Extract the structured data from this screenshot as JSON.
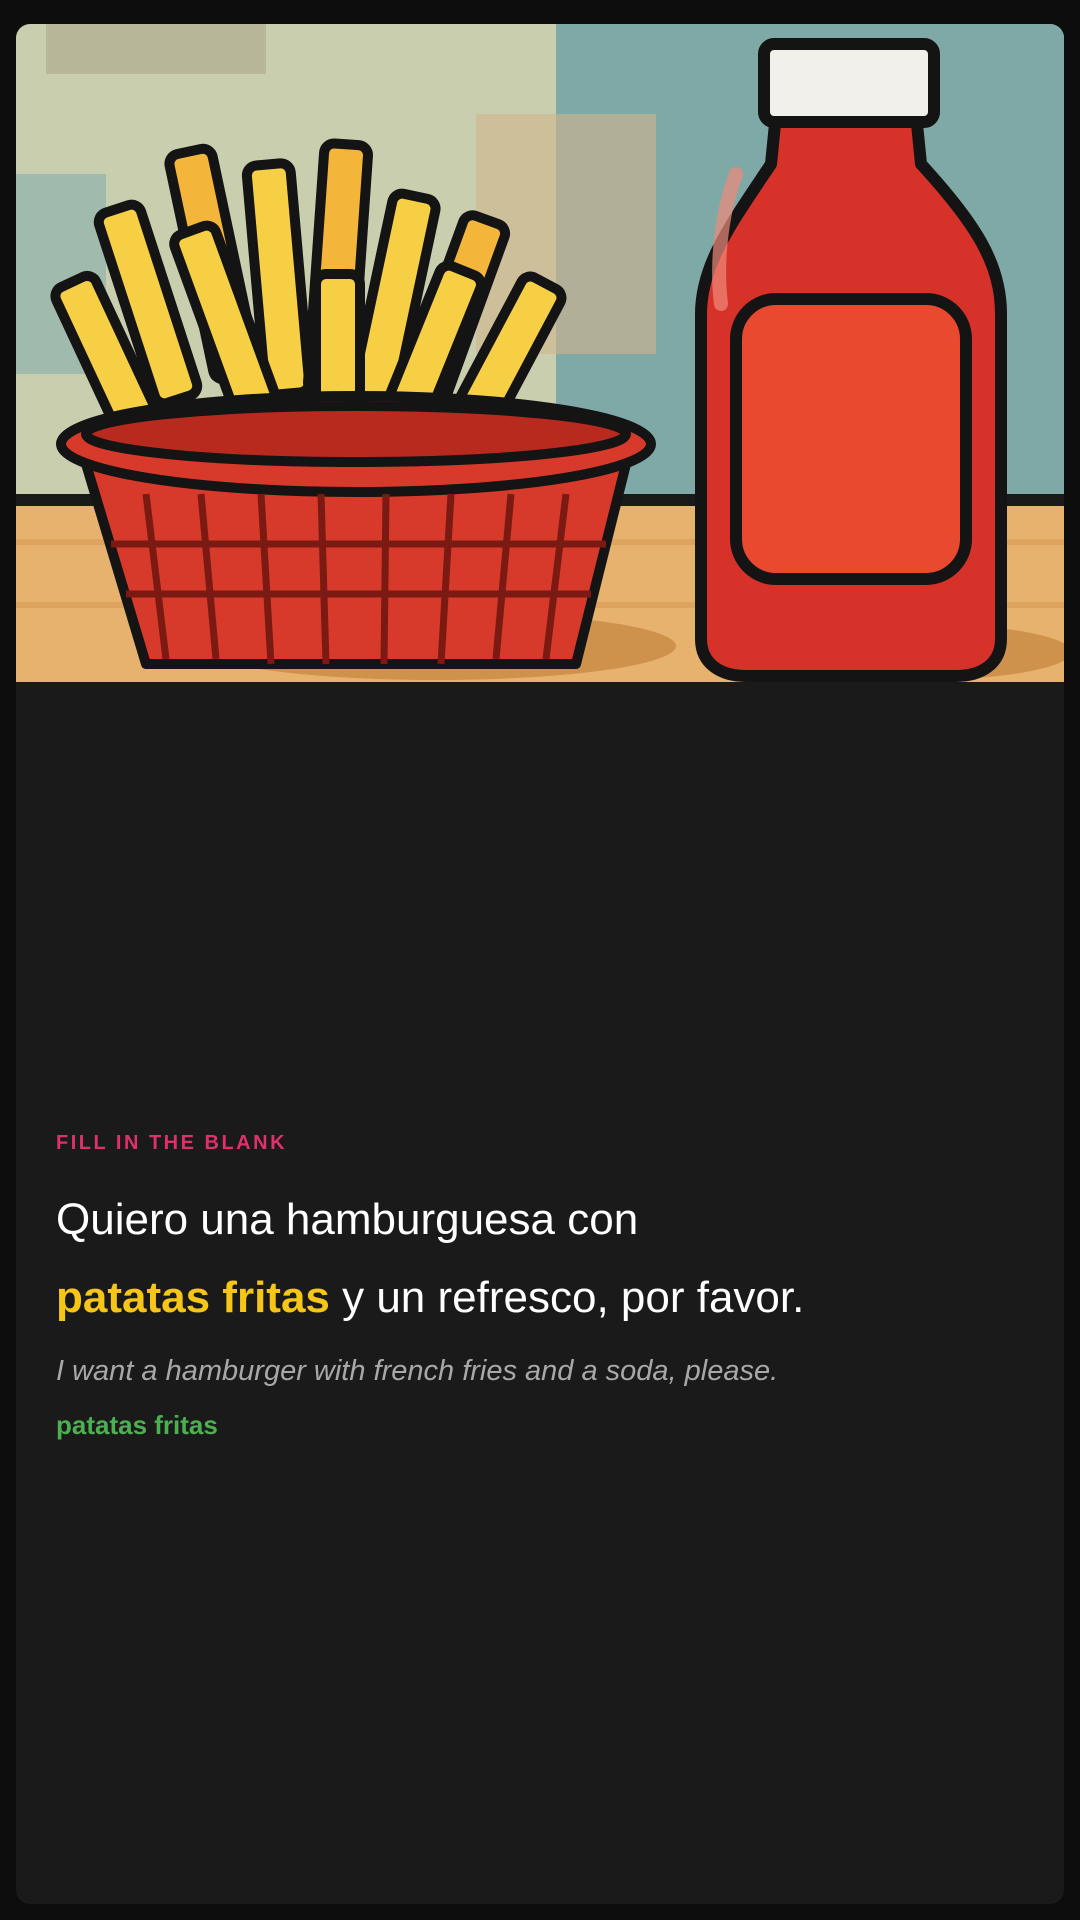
{
  "card": {
    "illustration": {
      "subject": "french fries in red basket with ketchup bottle",
      "icon_names": [
        "fries-basket-icon",
        "ketchup-bottle-icon"
      ],
      "colors": {
        "wall": "#c9cfae",
        "wall_teal": "#7fa9a6",
        "table": "#e7b26e",
        "basket": "#d73a2a",
        "fries": "#f7cf45",
        "ketchup": "#d6322a",
        "label": "#e8492f",
        "cap": "#f2f0ea"
      }
    },
    "exercise_type": "FILL IN THE BLANK",
    "sentence": {
      "before": "Quiero una hamburguesa con",
      "answer": "patatas fritas",
      "after": " y un refresco, por favor."
    },
    "translation": "I want a hamburger with french fries and a soda, please.",
    "answer_key": "patatas fritas",
    "colors": {
      "eyebrow": "#e0306b",
      "answer_highlight": "#f5c518",
      "answer_key": "#4caf50",
      "card_bg": "#1a1a1a"
    }
  }
}
